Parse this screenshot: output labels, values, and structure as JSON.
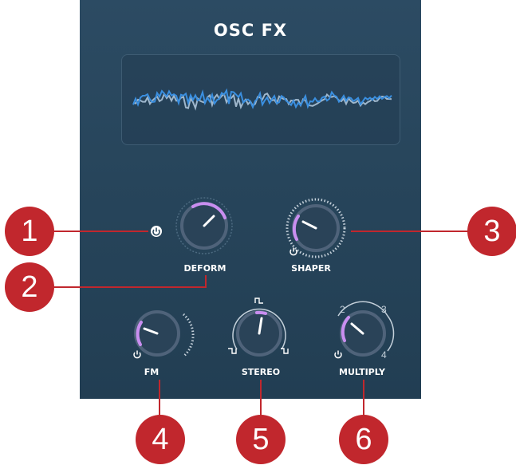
{
  "panel": {
    "title": "OSC FX"
  },
  "knobs": {
    "deform": {
      "label": "DEFORM",
      "value": 0.55,
      "power_on": true
    },
    "shaper": {
      "label": "SHAPER",
      "value": 0.15,
      "power_on": false
    },
    "fm": {
      "label": "FM",
      "value": 0.12,
      "power_on": false
    },
    "stereo": {
      "label": "STEREO",
      "value": 0.5
    },
    "multiply": {
      "label": "MULTIPLY",
      "value": 0.2,
      "power_on": false,
      "steps": [
        "2",
        "3",
        "4"
      ]
    }
  },
  "callouts": [
    "1",
    "2",
    "3",
    "4",
    "5",
    "6"
  ],
  "colors": {
    "accent": "#c98ef0",
    "callout": "#c1272d",
    "wave_blue": "#3a8fe0",
    "wave_light": "#9fb7cc"
  },
  "icons": {
    "power": "power-icon",
    "square_wave": "square-wave-icon"
  }
}
